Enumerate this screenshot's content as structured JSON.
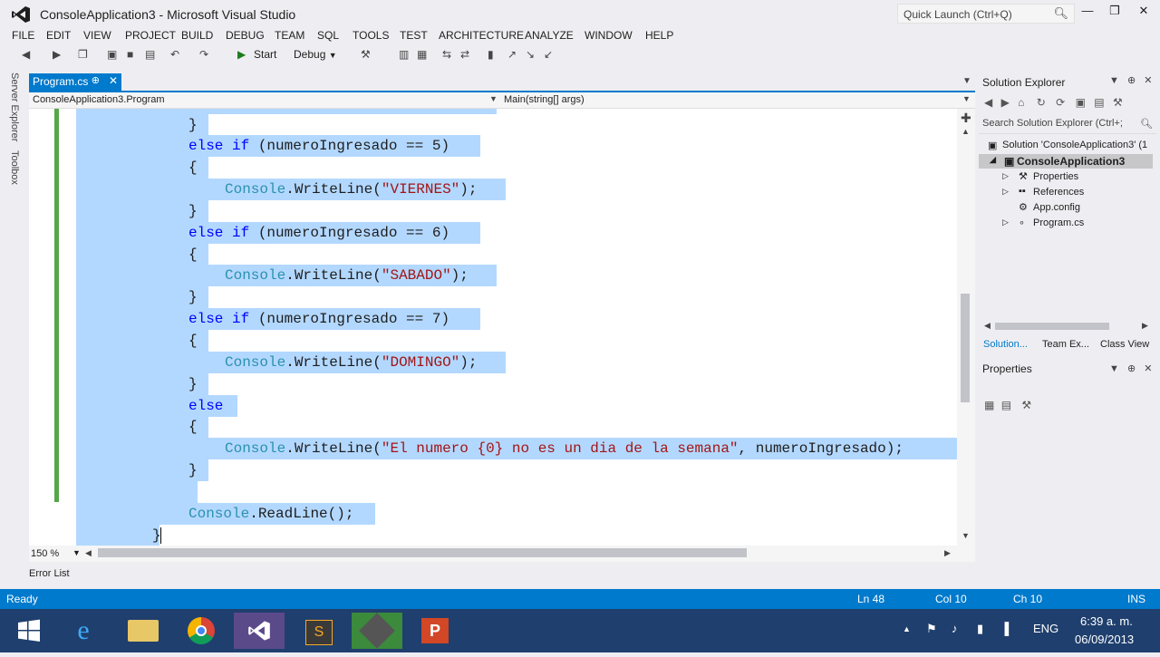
{
  "window": {
    "title": "ConsoleApplication3 - Microsoft Visual Studio",
    "quick_launch_placeholder": "Quick Launch (Ctrl+Q)"
  },
  "menu": [
    "FILE",
    "EDIT",
    "VIEW",
    "PROJECT",
    "BUILD",
    "DEBUG",
    "TEAM",
    "SQL",
    "TOOLS",
    "TEST",
    "ARCHITECTURE",
    "ANALYZE",
    "WINDOW",
    "HELP"
  ],
  "toolbar": {
    "start_label": "Start",
    "config": "Debug"
  },
  "side_panels": {
    "server_explorer": "Server Explorer",
    "toolbox": "Toolbox"
  },
  "tab": {
    "label": "Program.cs"
  },
  "nav": {
    "left": "ConsoleApplication3.Program",
    "right": "Main(string[] args)"
  },
  "code": {
    "else_kw": "else",
    "if_kw": "if",
    "console": "Console",
    "writeline": "WriteLine",
    "readline": "ReadLine",
    "cond5": " (numeroIngresado == 5)",
    "cond6": " (numeroIngresado == 6)",
    "cond7": " (numeroIngresado == 7)",
    "open": "{",
    "close": "}",
    "str_viernes": "\"VIERNES\"",
    "str_sabado": "\"SABADO\"",
    "str_domingo": "\"DOMINGO\"",
    "str_else": "\"El numero {0} no es un dia de la semana\"",
    "else_arg": ", numeroIngresado);",
    "paren_open": "(",
    "call_end": ");",
    "readline_end": "();"
  },
  "editor": {
    "zoom": "150 %"
  },
  "error_list": "Error List",
  "solution_explorer": {
    "title": "Solution Explorer",
    "search_placeholder": "Search Solution Explorer (Ctrl+;",
    "solution": "Solution 'ConsoleApplication3' (1",
    "project": "ConsoleApplication3",
    "items": [
      "Properties",
      "References",
      "App.config",
      "Program.cs"
    ],
    "tabs": [
      "Solution...",
      "Team Ex...",
      "Class View"
    ]
  },
  "properties": {
    "title": "Properties"
  },
  "status": {
    "ready": "Ready",
    "ln": "Ln 48",
    "col": "Col 10",
    "ch": "Ch 10",
    "ins": "INS"
  },
  "taskbar": {
    "lang": "ENG",
    "time": "6:39 a. m.",
    "date": "06/09/2013",
    "ppt_letter": "P",
    "s_letter": "S"
  },
  "colors": {
    "accent": "#007acc",
    "selection": "#b3d8ff",
    "keyword": "#0000ff",
    "class": "#2b91af",
    "string": "#a31515"
  }
}
